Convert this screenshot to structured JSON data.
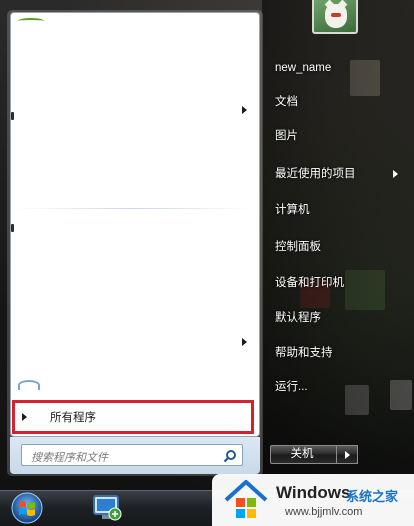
{
  "start_menu": {
    "all_programs_label": "所有程序",
    "search_placeholder": "搜索程序和文件",
    "right_items": [
      {
        "label": "new_name",
        "has_arrow": false
      },
      {
        "label": "文档",
        "has_arrow": false
      },
      {
        "label": "图片",
        "has_arrow": false
      },
      {
        "label": "最近使用的项目",
        "has_arrow": true
      },
      {
        "label": "计算机",
        "has_arrow": false
      },
      {
        "label": "控制面板",
        "has_arrow": false
      },
      {
        "label": "设备和打印机",
        "has_arrow": false
      },
      {
        "label": "默认程序",
        "has_arrow": false
      },
      {
        "label": "帮助和支持",
        "has_arrow": false
      },
      {
        "label": "运行...",
        "has_arrow": false
      }
    ],
    "shutdown_label": "关机"
  },
  "icons": {
    "start": "windows-orb-icon",
    "search": "magnifier-icon",
    "user": "lucky-cat-avatar",
    "taskbar_app": "remote-desktop-icon"
  },
  "colors": {
    "highlight_border": "#d7202d",
    "menu_bg": "#ffffff",
    "right_pane_text": "#ffffff"
  },
  "watermark": {
    "brand": "Windows",
    "suffix": "系统之家",
    "url": "www.bjjmlv.com"
  }
}
